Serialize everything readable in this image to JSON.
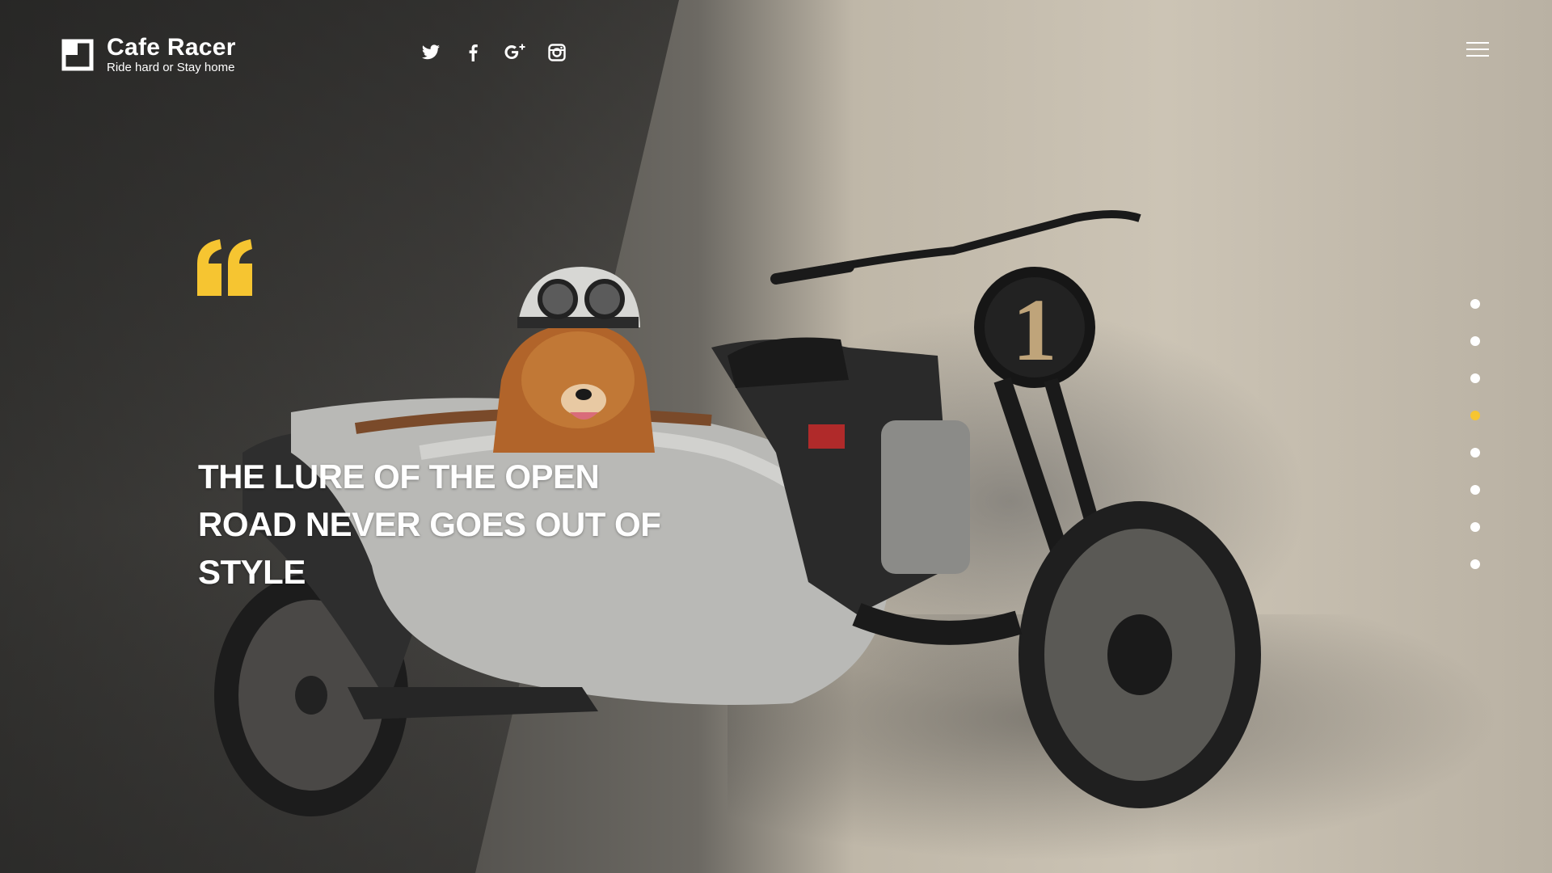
{
  "brand": {
    "name": "Cafe Racer",
    "tagline": "Ride hard or Stay home"
  },
  "social": [
    {
      "icon": "twitter-icon"
    },
    {
      "icon": "facebook-icon"
    },
    {
      "icon": "google-plus-icon"
    },
    {
      "icon": "instagram-icon"
    }
  ],
  "menu": {
    "icon": "hamburger-menu-icon"
  },
  "hero": {
    "quote_icon": "quote-icon",
    "headline": "THE LURE OF THE OPEN ROAD NEVER GOES OUT OF STYLE",
    "image": "dog in helmet sitting in motorcycle sidecar"
  },
  "pager": {
    "count": 8,
    "active_index": 3
  },
  "colors": {
    "accent": "#f6c531",
    "text": "#ffffff"
  }
}
